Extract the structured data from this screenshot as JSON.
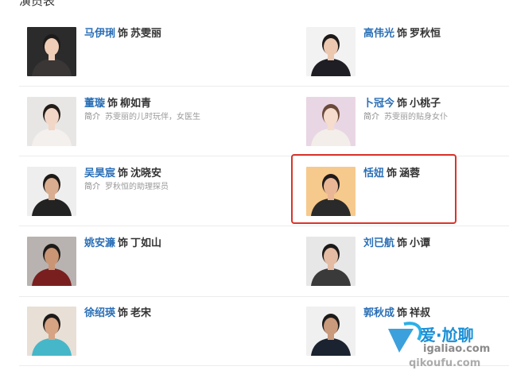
{
  "section": {
    "title": "演员表"
  },
  "cast": [
    {
      "actor": "马伊琍",
      "role_word": "饰",
      "character": "苏雯丽",
      "intro_label": "",
      "intro": "",
      "colors": {
        "bg": "#2b2b2b",
        "skin": "#f0cdb6",
        "hair": "#1d1b1a",
        "clothes": "#3a3636"
      }
    },
    {
      "actor": "高伟光",
      "role_word": "饰",
      "character": "罗秋恒",
      "intro_label": "",
      "intro": "",
      "colors": {
        "bg": "#f2f2f2",
        "skin": "#ecc8b1",
        "hair": "#1c1a19",
        "clothes": "#1e1e24"
      }
    },
    {
      "actor": "董璇",
      "role_word": "饰",
      "character": "柳如青",
      "intro_label": "简介",
      "intro": "苏雯丽的儿时玩伴，女医生",
      "colors": {
        "bg": "#e8e6e4",
        "skin": "#f2d6c6",
        "hair": "#231d1a",
        "clothes": "#f4f0ee"
      }
    },
    {
      "actor": "卜冠今",
      "role_word": "饰",
      "character": "小桃子",
      "intro_label": "简介",
      "intro": "苏雯丽的贴身女仆",
      "colors": {
        "bg": "#e9d6e4",
        "skin": "#f5dccd",
        "hair": "#6b4a3a",
        "clothes": "#f3eee9"
      }
    },
    {
      "actor": "吴昊宸",
      "role_word": "饰",
      "character": "沈晓安",
      "intro_label": "简介",
      "intro": "罗秋恒的助理探员",
      "colors": {
        "bg": "#eeeeee",
        "skin": "#d9ad8f",
        "hair": "#1d1a18",
        "clothes": "#222222"
      }
    },
    {
      "actor": "恬妞",
      "role_word": "饰",
      "character": "涵蓉",
      "intro_label": "",
      "intro": "",
      "colors": {
        "bg": "#f6c98c",
        "skin": "#e9b796",
        "hair": "#1e1b1a",
        "clothes": "#2a2a2a"
      }
    },
    {
      "actor": "姚安濂",
      "role_word": "饰",
      "character": "丁如山",
      "intro_label": "",
      "intro": "",
      "colors": {
        "bg": "#b8b3b0",
        "skin": "#c99574",
        "hair": "#1c1a19",
        "clothes": "#7a1f1f"
      }
    },
    {
      "actor": "刘已航",
      "role_word": "饰",
      "character": "小谭",
      "intro_label": "",
      "intro": "",
      "colors": {
        "bg": "#e7e7e7",
        "skin": "#e3bca3",
        "hair": "#1c1a19",
        "clothes": "#3a3a3a"
      }
    },
    {
      "actor": "徐绍瑛",
      "role_word": "饰",
      "character": "老宋",
      "intro_label": "",
      "intro": "",
      "colors": {
        "bg": "#e8dfd6",
        "skin": "#d6a383",
        "hair": "#1d1b1a",
        "clothes": "#45b7c9"
      }
    },
    {
      "actor": "郭秋成",
      "role_word": "饰",
      "character": "祥叔",
      "intro_label": "",
      "intro": "",
      "colors": {
        "bg": "#f0f0f0",
        "skin": "#c99a7c",
        "hair": "#1d1b1a",
        "clothes": "#1b2330"
      }
    }
  ],
  "watermark": {
    "line1": "爱·尬聊",
    "line2": "igaliao.com",
    "line3": "qikoufu.com",
    "colors": {
      "blue": "#1a8fd6",
      "gray": "#8a8a8a",
      "cyan": "#2bb0e8"
    }
  },
  "accent": {
    "highlight": "#d9342b",
    "link": "#2a6fb6"
  }
}
